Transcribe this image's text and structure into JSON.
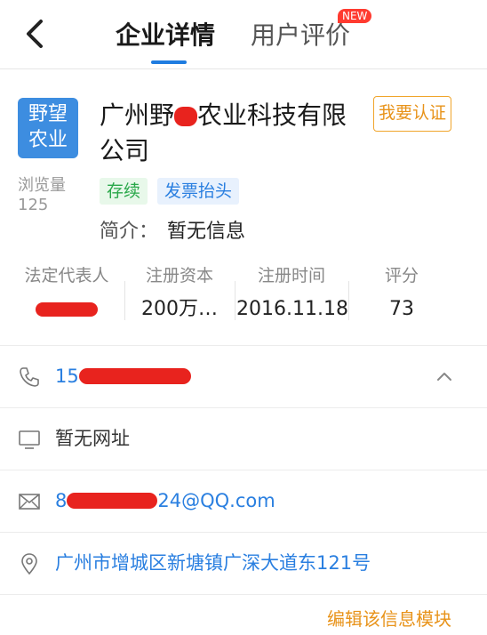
{
  "header": {
    "tab_active": "企业详情",
    "tab_reviews": "用户评价",
    "new_badge": "NEW"
  },
  "company": {
    "logo_line1": "野望",
    "logo_line2": "农业",
    "views_label": "浏览量",
    "views_count": "125",
    "name_part1": "广州野",
    "name_part2": "农业科技有限",
    "name_line2": "公司",
    "cert_button": "我要认证",
    "tags": [
      "存续",
      "发票抬头"
    ],
    "intro_label": "简介：",
    "intro_value": "暂无信息"
  },
  "stats": [
    {
      "label": "法定代表人",
      "value": ""
    },
    {
      "label": "注册资本",
      "value": "200万…"
    },
    {
      "label": "注册时间",
      "value": "2016.11.18"
    },
    {
      "label": "评分",
      "value": "73"
    }
  ],
  "contact": {
    "phone": "15",
    "website": "暂无网址",
    "email_prefix": "8",
    "email_suffix": "24@QQ.com",
    "address": "广州市增城区新塘镇广深大道东121号"
  },
  "footer": {
    "edit_link": "编辑该信息模块"
  },
  "colors": {
    "accent_blue": "#1f7ce0",
    "link_blue": "#2a7fe0",
    "orange": "#e8931a",
    "green": "#2aa84a",
    "redaction": "#e8231e"
  }
}
